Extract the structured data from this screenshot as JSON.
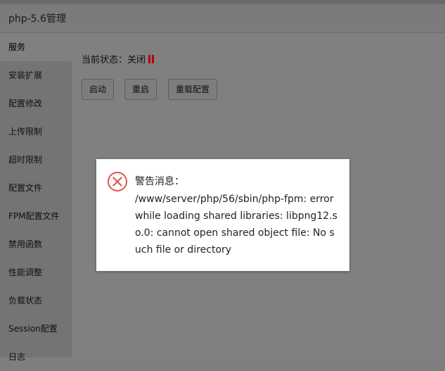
{
  "window": {
    "title": "php-5.6管理"
  },
  "sidebar": {
    "items": [
      {
        "label": "服务",
        "active": true
      },
      {
        "label": "安装扩展"
      },
      {
        "label": "配置修改"
      },
      {
        "label": "上传限制"
      },
      {
        "label": "超时限制"
      },
      {
        "label": "配置文件"
      },
      {
        "label": "FPM配置文件"
      },
      {
        "label": "禁用函数"
      },
      {
        "label": "性能调整"
      },
      {
        "label": "负载状态"
      },
      {
        "label": "Session配置"
      },
      {
        "label": "日志"
      }
    ]
  },
  "main": {
    "status_text": "当前状态：关闭",
    "status_icon": "pause-icon",
    "status_color": "#b40000",
    "buttons": {
      "start": "启动",
      "restart": "重启",
      "reload": "重载配置"
    }
  },
  "dialog": {
    "icon": "error-x-circle-icon",
    "title": "警告消息：",
    "message": "/www/server/php/56/sbin/php-fpm: error while loading shared libraries: libpng12.so.0: cannot open shared object file: No such file or directory"
  }
}
